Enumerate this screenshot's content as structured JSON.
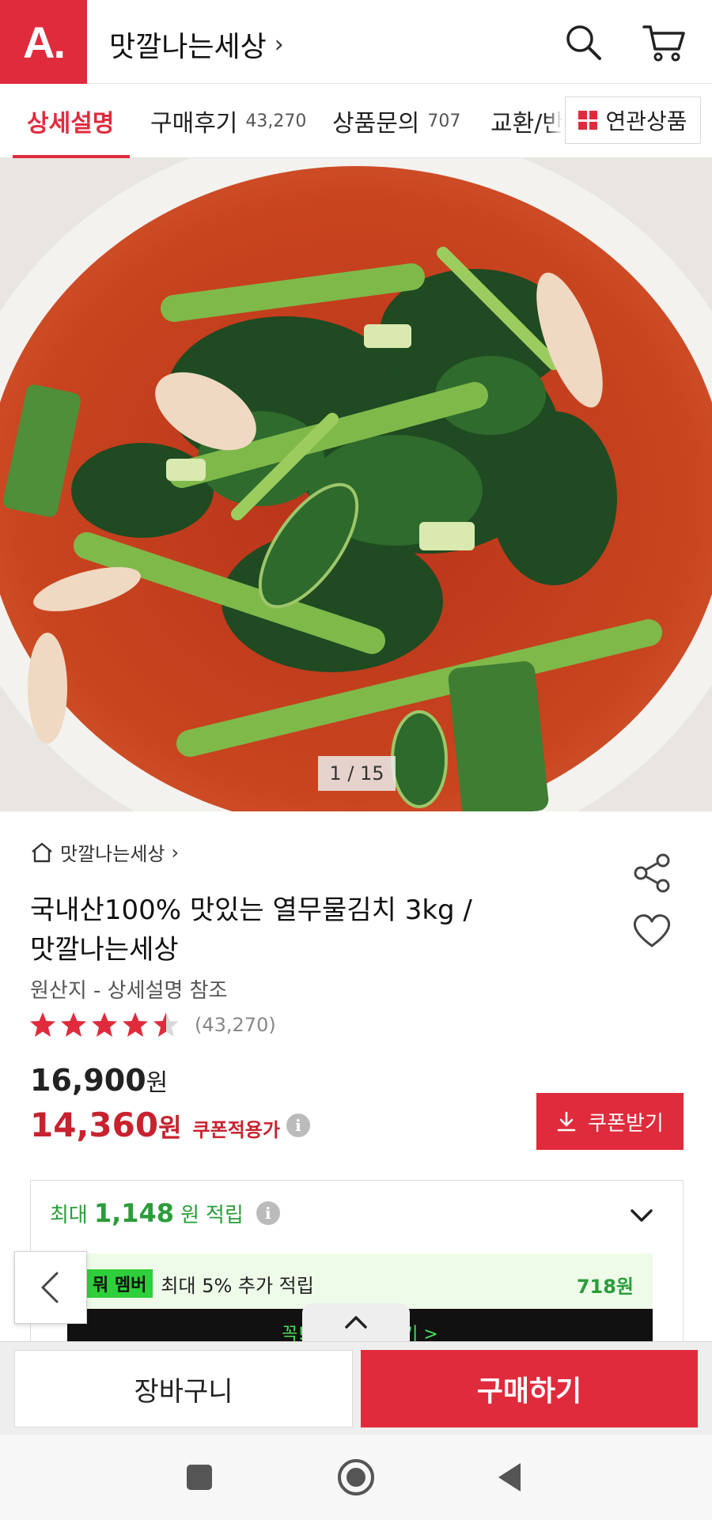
{
  "header": {
    "logo_text": "A.",
    "store_title": "맛깔나는세상",
    "title_chevron": "›"
  },
  "tabs": [
    {
      "label": "상세설명",
      "count": ""
    },
    {
      "label": "구매후기",
      "count": "43,270"
    },
    {
      "label": "상품문의",
      "count": "707"
    },
    {
      "label": "교환/반",
      "count": ""
    }
  ],
  "related_button": {
    "label": "연관상품"
  },
  "image_counter": "1 / 15",
  "product": {
    "shop_link": "맛깔나는세상",
    "shop_chevron": "›",
    "title_line1": "국내산100% 맛있는 열무물김치 3kg /",
    "title_line2": "맛깔나는세상",
    "origin": "원산지 - 상세설명 참조",
    "rating": 4.5,
    "rating_count": "(43,270)",
    "original_price": "16,900",
    "original_price_unit": "원",
    "sale_price": "14,360",
    "sale_price_unit": "원",
    "coupon_price_label": "쿠폰적용가",
    "coupon_button": "쿠폰받기"
  },
  "points": {
    "prefix": "최대",
    "amount": "1,148",
    "unit": "원",
    "suffix": "적립",
    "member_badge_lead": "뭐",
    "member_badge": "멤버",
    "member_text": "최대 5% 추가 적립",
    "member_amount": "718원",
    "banner_text": "꼭! 시작하 ... 받기  >"
  },
  "bottom": {
    "cart_label": "장바구니",
    "buy_label": "구매하기"
  },
  "colors": {
    "brand_red": "#e02b3c",
    "price_red": "#c8222f",
    "points_green": "#2a9d3a"
  },
  "icons": [
    "search-icon",
    "cart-icon",
    "home-icon",
    "share-icon",
    "heart-icon",
    "star-icon",
    "info-icon",
    "download-icon",
    "chevron-down-icon",
    "chevron-left-icon",
    "chevron-up-icon",
    "recent-apps-icon",
    "home-circle-icon",
    "back-triangle-icon"
  ]
}
